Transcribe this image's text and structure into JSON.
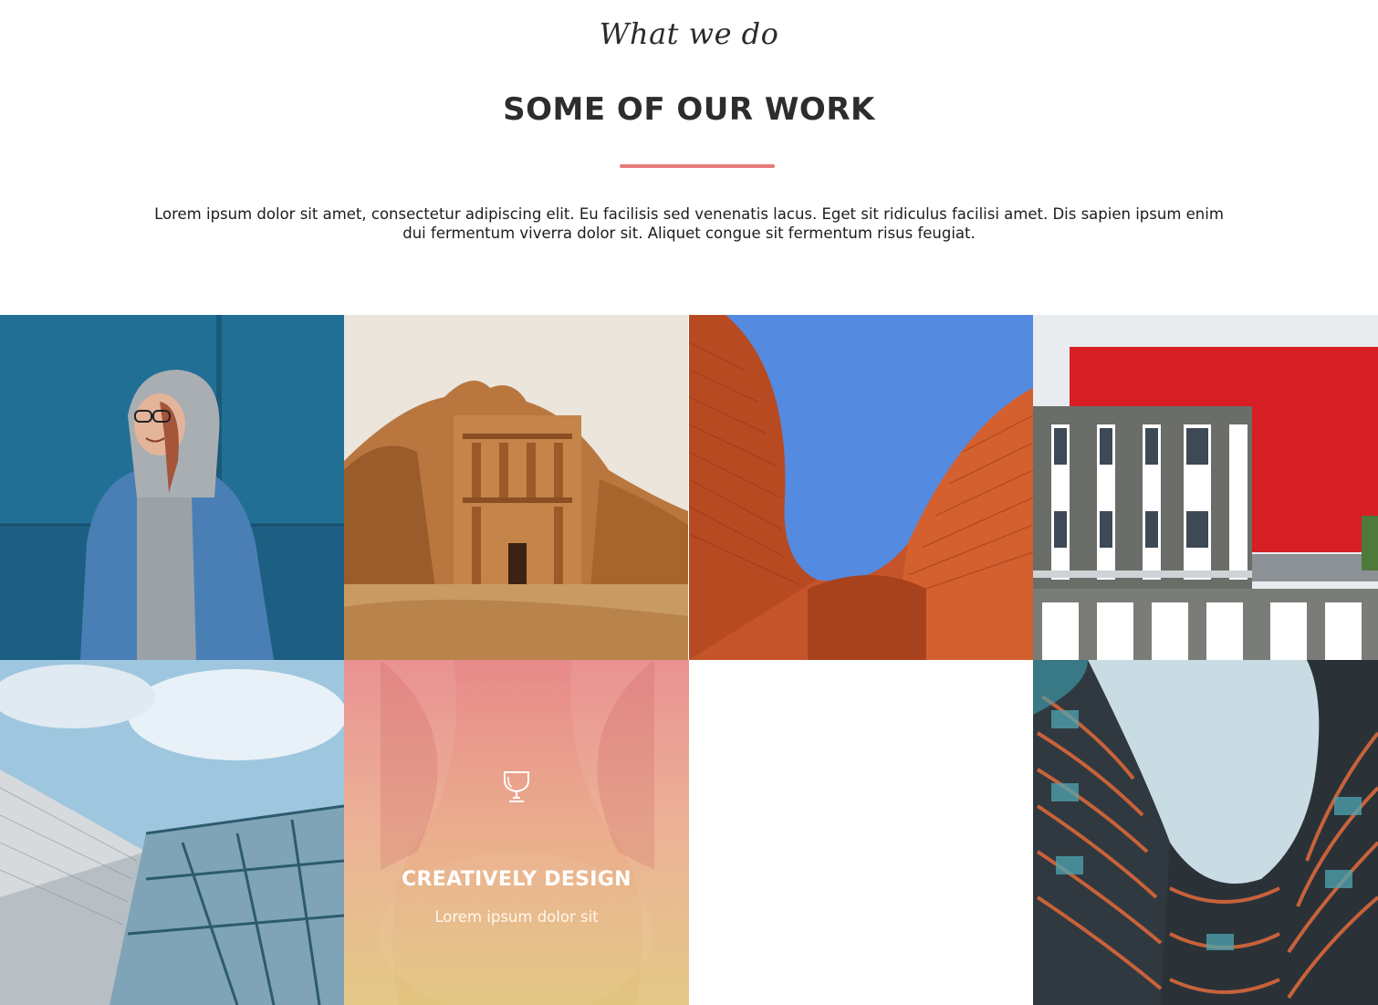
{
  "section": {
    "eyebrow": "What we do",
    "title": "SOME OF OUR WORK",
    "intro": "Lorem ipsum dolor sit amet, consectetur adipiscing elit. Eu facilisis sed venenatis lacus. Eget sit ridiculus facilisi amet. Dis sapien ipsum enim dui fermentum viverra dolor sit. Aliquet congue sit fermentum risus feugiat.",
    "accent_color": "#e8797a"
  },
  "gallery": {
    "feature_tile": {
      "icon": "trophy-icon",
      "title": "CREATIVELY DESIGN",
      "subtitle": "Lorem ipsum dolor sit"
    }
  }
}
